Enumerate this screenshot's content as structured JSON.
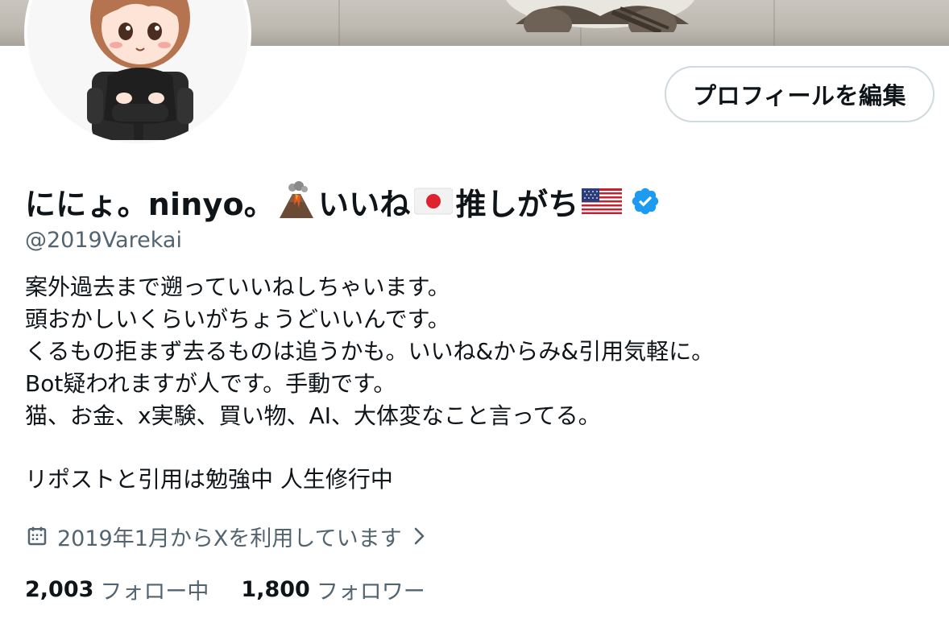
{
  "profile": {
    "edit_button_label": "プロフィールを編集",
    "display_name": {
      "part1": "ににょ。ninyo。",
      "part2": "いいね",
      "part3": "推しがち"
    },
    "emoji": {
      "volcano": "volcano-icon",
      "japan_flag": "japan-flag-icon",
      "us_flag": "us-flag-icon",
      "verified": "verified-badge-icon"
    },
    "handle": "@2019Varekai",
    "bio_lines": [
      "案外過去まで遡っていいねしちゃいます。",
      "頭おかしいくらいがちょうどいいんです。",
      "くるもの拒まず去るものは追うかも。いいね&からみ&引用気軽に。",
      "Bot疑われますが人です。手動です。",
      "猫、お金、x実験、買い物、AI、大体変なこと言ってる。",
      "",
      "リポストと引用は勉強中 人生修行中"
    ],
    "joined_text": "2019年1月からXを利用しています",
    "following_count": "2,003",
    "following_label": "フォロー中",
    "followers_count": "1,800",
    "followers_label": "フォロワー"
  },
  "colors": {
    "text_primary": "#0f1419",
    "text_secondary": "#536471",
    "button_border": "#cfd9de",
    "verified_blue": "#1d9bf0"
  }
}
